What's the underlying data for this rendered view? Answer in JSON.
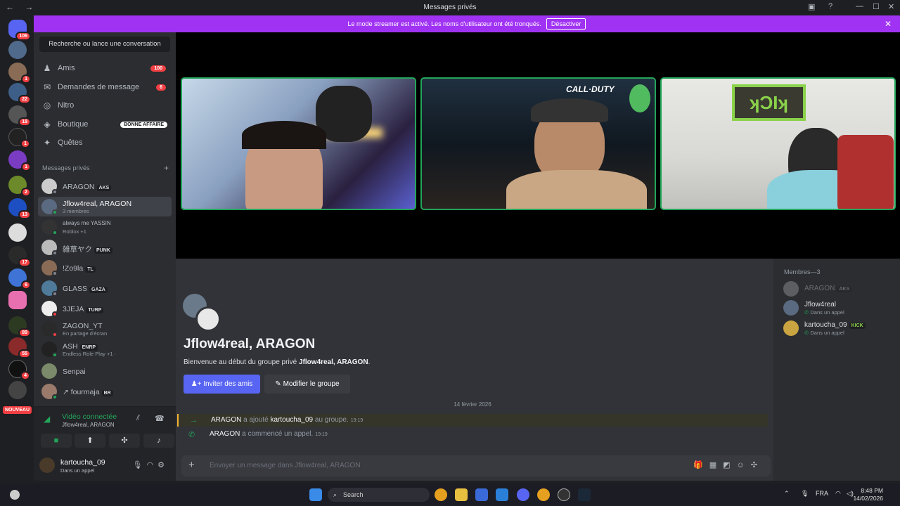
{
  "window": {
    "title": "Messages privés",
    "nav": "← →"
  },
  "banner": {
    "text": "Le mode streamer est activé. Les noms d'utilisateur ont été tronqués.",
    "button": "Désactiver"
  },
  "servers": {
    "badges": [
      "106",
      "1",
      "22",
      "18",
      "1",
      "1",
      "2",
      "13",
      "17",
      "6",
      "89",
      "55",
      "4"
    ],
    "nouveau": "NOUVEAU"
  },
  "sidebar": {
    "search": "Recherche ou lance une conversation",
    "nav": [
      {
        "label": "Amis",
        "count": "100"
      },
      {
        "label": "Demandes de message",
        "count": "6"
      },
      {
        "label": "Nitro"
      },
      {
        "label": "Boutique",
        "deal": "BONNE AFFAIRE"
      },
      {
        "label": "Quêtes"
      }
    ],
    "section": "Messages privés",
    "dms": [
      {
        "name": "ARAGON",
        "tag": "AKS"
      },
      {
        "name": "Jflow4real, ARAGON",
        "sub": "3 membres"
      },
      {
        "name": "always me YASSIN",
        "sub": "Roblox +1"
      },
      {
        "name": "雑草ヤク",
        "tag": "PUNK"
      },
      {
        "name": "!Zo9la",
        "tag": "TL"
      },
      {
        "name": "GLASS",
        "tag": "GAZA"
      },
      {
        "name": "3JEJA",
        "tag": "TURP"
      },
      {
        "name": "ZAGON_YT",
        "sub": "En partage d'écran"
      },
      {
        "name": "ASH",
        "tag": "ENRP",
        "sub": "Endless Role Play +1 ·"
      },
      {
        "name": "Senpai"
      },
      {
        "name": "↗ fourmaja",
        "tag": "BR"
      }
    ]
  },
  "voice": {
    "status": "Vidéo connectée",
    "channel": "Jflow4real, ARAGON"
  },
  "user": {
    "name": "kartoucha_09",
    "status": "Dans un appel"
  },
  "group": {
    "name": "Jflow4real, ARAGON",
    "welcome_prefix": "Bienvenue au début du groupe privé ",
    "welcome_name": "Jflow4real, ARAGON",
    "welcome_suffix": ".",
    "invite": "Inviter des amis",
    "edit": "Modifier le groupe"
  },
  "messages": {
    "date": "14 février 2026",
    "items": [
      {
        "user": "ARAGON",
        "action": "a ajouté",
        "target": "kartoucha_09",
        "rest": "au groupe.",
        "time": "19:19"
      },
      {
        "user": "ARAGON",
        "action": "a commencé un appel.",
        "time": "19:19"
      }
    ]
  },
  "composer": {
    "placeholder": "Envoyer un message dans Jflow4real, ARAGON"
  },
  "members": {
    "header": "Membres—3",
    "list": [
      {
        "name": "ARAGON",
        "tag": "AKS"
      },
      {
        "name": "Jflow4real",
        "sub": "Dans un appel"
      },
      {
        "name": "kartoucha_09",
        "tag": "KICK",
        "sub": "Dans un appel"
      }
    ]
  },
  "taskbar": {
    "search": "Search",
    "lang": "FRA",
    "time": "8:48 PM",
    "date": "14/02/2026"
  },
  "colors": {
    "accent": "#5865f2",
    "banner": "#a033f3",
    "online": "#23a55a",
    "badge": "#f23f43"
  }
}
